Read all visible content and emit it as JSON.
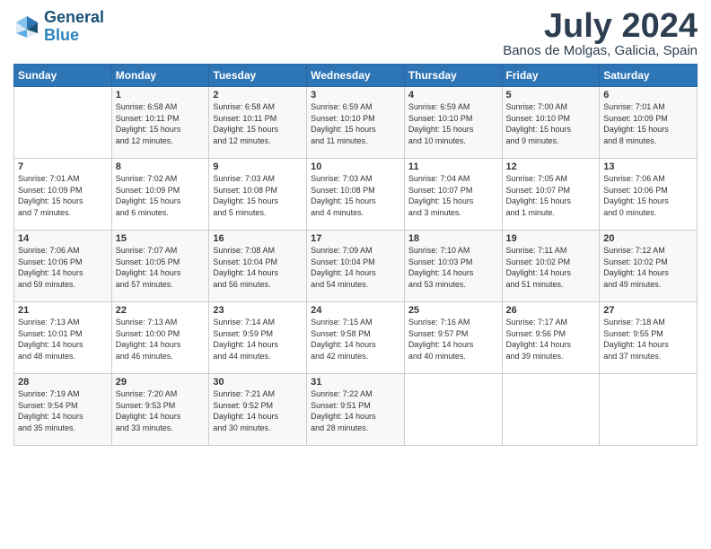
{
  "logo": {
    "line1": "General",
    "line2": "Blue"
  },
  "title": "July 2024",
  "location": "Banos de Molgas, Galicia, Spain",
  "days_of_week": [
    "Sunday",
    "Monday",
    "Tuesday",
    "Wednesday",
    "Thursday",
    "Friday",
    "Saturday"
  ],
  "weeks": [
    [
      {
        "day": "",
        "content": ""
      },
      {
        "day": "1",
        "content": "Sunrise: 6:58 AM\nSunset: 10:11 PM\nDaylight: 15 hours\nand 12 minutes."
      },
      {
        "day": "2",
        "content": "Sunrise: 6:58 AM\nSunset: 10:11 PM\nDaylight: 15 hours\nand 12 minutes."
      },
      {
        "day": "3",
        "content": "Sunrise: 6:59 AM\nSunset: 10:10 PM\nDaylight: 15 hours\nand 11 minutes."
      },
      {
        "day": "4",
        "content": "Sunrise: 6:59 AM\nSunset: 10:10 PM\nDaylight: 15 hours\nand 10 minutes."
      },
      {
        "day": "5",
        "content": "Sunrise: 7:00 AM\nSunset: 10:10 PM\nDaylight: 15 hours\nand 9 minutes."
      },
      {
        "day": "6",
        "content": "Sunrise: 7:01 AM\nSunset: 10:09 PM\nDaylight: 15 hours\nand 8 minutes."
      }
    ],
    [
      {
        "day": "7",
        "content": "Sunrise: 7:01 AM\nSunset: 10:09 PM\nDaylight: 15 hours\nand 7 minutes."
      },
      {
        "day": "8",
        "content": "Sunrise: 7:02 AM\nSunset: 10:09 PM\nDaylight: 15 hours\nand 6 minutes."
      },
      {
        "day": "9",
        "content": "Sunrise: 7:03 AM\nSunset: 10:08 PM\nDaylight: 15 hours\nand 5 minutes."
      },
      {
        "day": "10",
        "content": "Sunrise: 7:03 AM\nSunset: 10:08 PM\nDaylight: 15 hours\nand 4 minutes."
      },
      {
        "day": "11",
        "content": "Sunrise: 7:04 AM\nSunset: 10:07 PM\nDaylight: 15 hours\nand 3 minutes."
      },
      {
        "day": "12",
        "content": "Sunrise: 7:05 AM\nSunset: 10:07 PM\nDaylight: 15 hours\nand 1 minute."
      },
      {
        "day": "13",
        "content": "Sunrise: 7:06 AM\nSunset: 10:06 PM\nDaylight: 15 hours\nand 0 minutes."
      }
    ],
    [
      {
        "day": "14",
        "content": "Sunrise: 7:06 AM\nSunset: 10:06 PM\nDaylight: 14 hours\nand 59 minutes."
      },
      {
        "day": "15",
        "content": "Sunrise: 7:07 AM\nSunset: 10:05 PM\nDaylight: 14 hours\nand 57 minutes."
      },
      {
        "day": "16",
        "content": "Sunrise: 7:08 AM\nSunset: 10:04 PM\nDaylight: 14 hours\nand 56 minutes."
      },
      {
        "day": "17",
        "content": "Sunrise: 7:09 AM\nSunset: 10:04 PM\nDaylight: 14 hours\nand 54 minutes."
      },
      {
        "day": "18",
        "content": "Sunrise: 7:10 AM\nSunset: 10:03 PM\nDaylight: 14 hours\nand 53 minutes."
      },
      {
        "day": "19",
        "content": "Sunrise: 7:11 AM\nSunset: 10:02 PM\nDaylight: 14 hours\nand 51 minutes."
      },
      {
        "day": "20",
        "content": "Sunrise: 7:12 AM\nSunset: 10:02 PM\nDaylight: 14 hours\nand 49 minutes."
      }
    ],
    [
      {
        "day": "21",
        "content": "Sunrise: 7:13 AM\nSunset: 10:01 PM\nDaylight: 14 hours\nand 48 minutes."
      },
      {
        "day": "22",
        "content": "Sunrise: 7:13 AM\nSunset: 10:00 PM\nDaylight: 14 hours\nand 46 minutes."
      },
      {
        "day": "23",
        "content": "Sunrise: 7:14 AM\nSunset: 9:59 PM\nDaylight: 14 hours\nand 44 minutes."
      },
      {
        "day": "24",
        "content": "Sunrise: 7:15 AM\nSunset: 9:58 PM\nDaylight: 14 hours\nand 42 minutes."
      },
      {
        "day": "25",
        "content": "Sunrise: 7:16 AM\nSunset: 9:57 PM\nDaylight: 14 hours\nand 40 minutes."
      },
      {
        "day": "26",
        "content": "Sunrise: 7:17 AM\nSunset: 9:56 PM\nDaylight: 14 hours\nand 39 minutes."
      },
      {
        "day": "27",
        "content": "Sunrise: 7:18 AM\nSunset: 9:55 PM\nDaylight: 14 hours\nand 37 minutes."
      }
    ],
    [
      {
        "day": "28",
        "content": "Sunrise: 7:19 AM\nSunset: 9:54 PM\nDaylight: 14 hours\nand 35 minutes."
      },
      {
        "day": "29",
        "content": "Sunrise: 7:20 AM\nSunset: 9:53 PM\nDaylight: 14 hours\nand 33 minutes."
      },
      {
        "day": "30",
        "content": "Sunrise: 7:21 AM\nSunset: 9:52 PM\nDaylight: 14 hours\nand 30 minutes."
      },
      {
        "day": "31",
        "content": "Sunrise: 7:22 AM\nSunset: 9:51 PM\nDaylight: 14 hours\nand 28 minutes."
      },
      {
        "day": "",
        "content": ""
      },
      {
        "day": "",
        "content": ""
      },
      {
        "day": "",
        "content": ""
      }
    ]
  ]
}
